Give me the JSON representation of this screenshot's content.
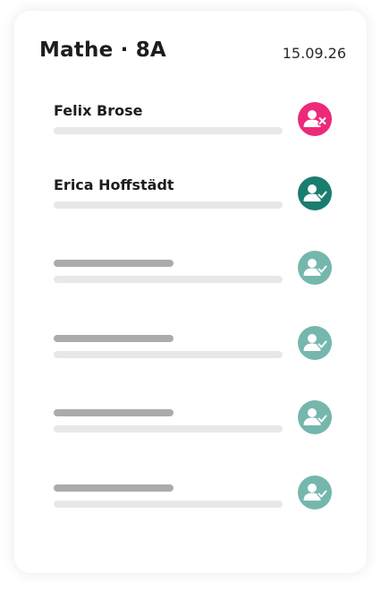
{
  "header": {
    "title": "Mathe · 8A",
    "date": "15.09.26"
  },
  "students": [
    {
      "name": "Felix Brose",
      "status": "absent",
      "status_icon": "user-x-icon",
      "status_color": "#ec2a79"
    },
    {
      "name": "Erica Hoffstädt",
      "status": "present",
      "status_icon": "user-check-icon",
      "status_color": "#1a7d6e"
    },
    {
      "name": "",
      "status": "present",
      "status_icon": "user-check-icon",
      "status_color": "#75b7ad"
    },
    {
      "name": "",
      "status": "present",
      "status_icon": "user-check-icon",
      "status_color": "#75b7ad"
    },
    {
      "name": "",
      "status": "present",
      "status_icon": "user-check-icon",
      "status_color": "#75b7ad"
    },
    {
      "name": "",
      "status": "present",
      "status_icon": "user-check-icon",
      "status_color": "#75b7ad"
    }
  ]
}
